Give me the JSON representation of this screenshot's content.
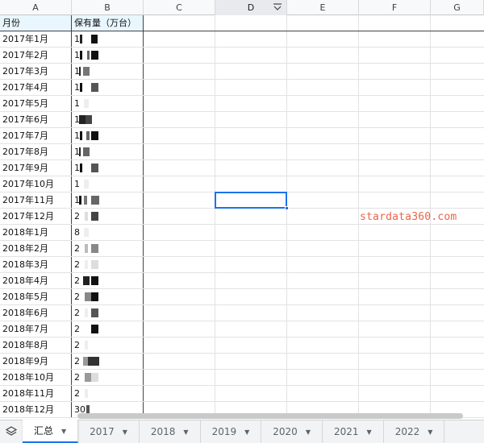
{
  "columns": [
    "A",
    "B",
    "C",
    "D",
    "E",
    "F",
    "G"
  ],
  "selected_column": "D",
  "header_row": {
    "a": "月份",
    "b": "保有量（万台）"
  },
  "rows": [
    {
      "a": "2017年1月",
      "b": "1"
    },
    {
      "a": "2017年2月",
      "b": "1"
    },
    {
      "a": "2017年3月",
      "b": "1"
    },
    {
      "a": "2017年4月",
      "b": "1"
    },
    {
      "a": "2017年5月",
      "b": "1"
    },
    {
      "a": "2017年6月",
      "b": "1"
    },
    {
      "a": "2017年7月",
      "b": "1"
    },
    {
      "a": "2017年8月",
      "b": "1"
    },
    {
      "a": "2017年9月",
      "b": "1"
    },
    {
      "a": "2017年10月",
      "b": "1"
    },
    {
      "a": "2017年11月",
      "b": "1"
    },
    {
      "a": "2017年12月",
      "b": "2"
    },
    {
      "a": "2018年1月",
      "b": "8"
    },
    {
      "a": "2018年2月",
      "b": "2"
    },
    {
      "a": "2018年3月",
      "b": "2"
    },
    {
      "a": "2018年4月",
      "b": "2"
    },
    {
      "a": "2018年5月",
      "b": "2"
    },
    {
      "a": "2018年6月",
      "b": "2"
    },
    {
      "a": "2018年7月",
      "b": "2"
    },
    {
      "a": "2018年8月",
      "b": "2"
    },
    {
      "a": "2018年9月",
      "b": "2"
    },
    {
      "a": "2018年10月",
      "b": "2"
    },
    {
      "a": "2018年11月",
      "b": "2"
    },
    {
      "a": "2018年12月",
      "b": "30"
    }
  ],
  "watermark": "stardata360.com",
  "sheet_tabs": [
    {
      "label": "汇总",
      "active": true
    },
    {
      "label": "2017",
      "active": false
    },
    {
      "label": "2018",
      "active": false
    },
    {
      "label": "2019",
      "active": false
    },
    {
      "label": "2020",
      "active": false
    },
    {
      "label": "2021",
      "active": false
    },
    {
      "label": "2022",
      "active": false
    }
  ],
  "icons": {
    "sheets_menu": "layers-icon",
    "filter": "filter-icon",
    "tab_menu": "caret-down-icon"
  },
  "colors": {
    "accent": "#1a73e8",
    "header_fill": "#e9f6fd",
    "watermark": "#e8654a"
  }
}
